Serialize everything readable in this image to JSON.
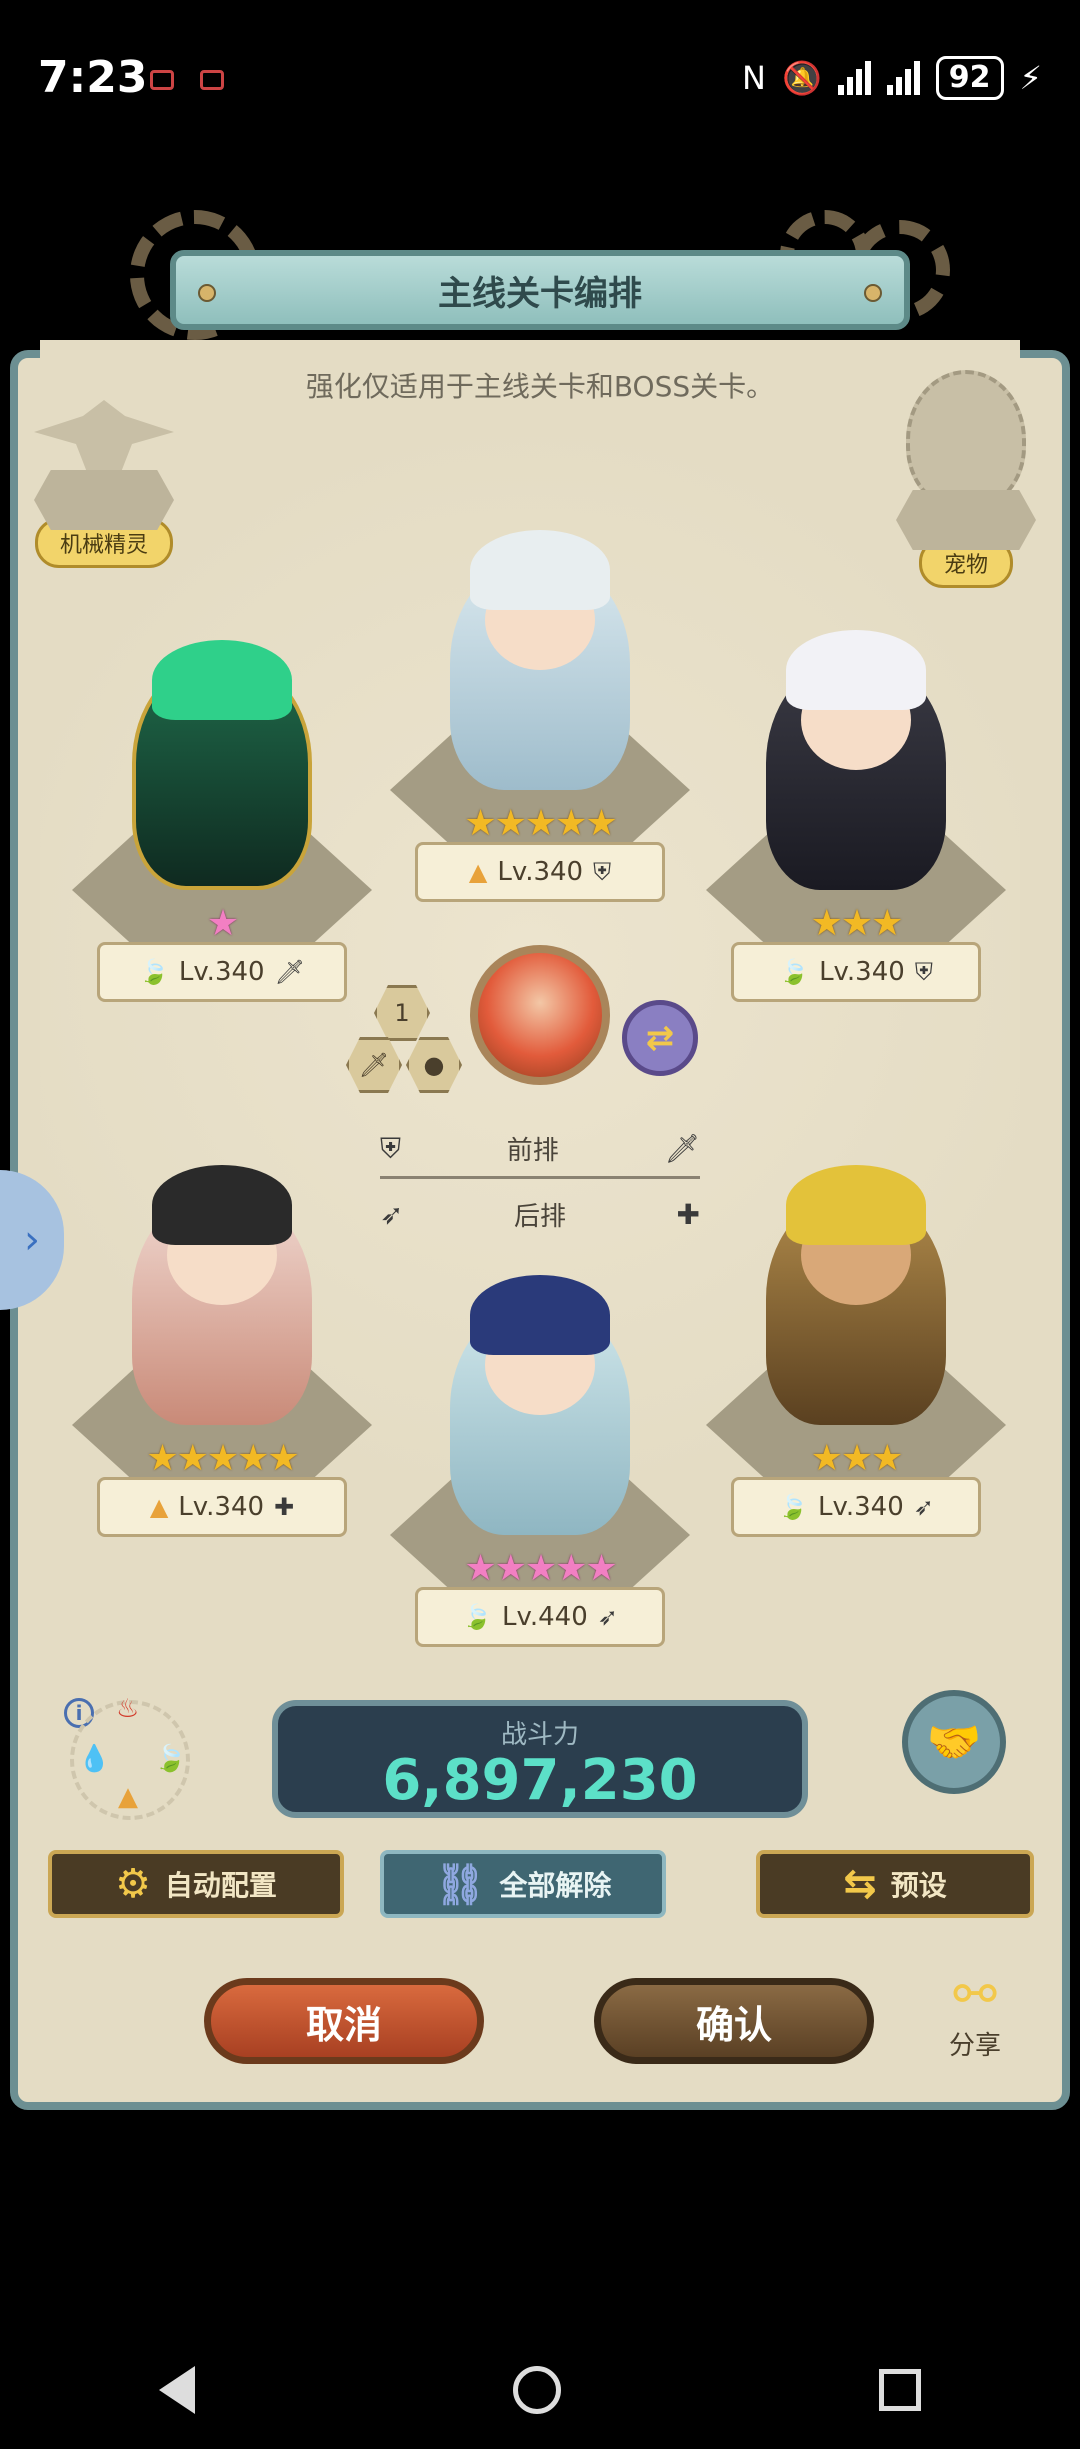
{
  "status_bar": {
    "time": "7:23",
    "battery": "92",
    "icons": [
      "nfc-icon",
      "mute-icon",
      "signal-icon",
      "signal-icon",
      "battery-icon",
      "charging-icon"
    ]
  },
  "dialog": {
    "title": "主线关卡编排",
    "subtitle": "强化仅适用于主线关卡和BOSS关卡。",
    "left_slot_label": "机械精灵",
    "right_slot_label": "宠物"
  },
  "heroes": [
    {
      "stars": "★",
      "star_color": "pink",
      "level": "Lv.340",
      "element": "wind",
      "role": "sword"
    },
    {
      "stars": "★★★★★",
      "star_color": "gold",
      "level": "Lv.340",
      "element": "earth",
      "role": "shield"
    },
    {
      "stars": "★★★",
      "star_color": "gold",
      "level": "Lv.340",
      "element": "wind",
      "role": "shield"
    },
    {
      "stars": "★★★★★",
      "star_color": "gold",
      "level": "Lv.340",
      "element": "earth",
      "role": "heal"
    },
    {
      "stars": "★★★★★",
      "star_color": "pink",
      "level": "Lv.440",
      "element": "wind",
      "role": "bow"
    },
    {
      "stars": "★★★",
      "star_color": "gold",
      "level": "Lv.340",
      "element": "wind",
      "role": "bow"
    }
  ],
  "center_hub": {
    "rank": "1"
  },
  "row_legend": {
    "front": "前排",
    "back": "后排"
  },
  "power": {
    "label": "战斗力",
    "value": "6,897,230"
  },
  "buttons": {
    "auto": "自动配置",
    "clear_all": "全部解除",
    "preset": "预设",
    "cancel": "取消",
    "confirm": "确认",
    "share": "分享"
  },
  "colors": {
    "panel": "#e4dcc4",
    "banner": "#8fbfbc",
    "power_value": "#5ce0c8",
    "cancel": "#c0532e"
  }
}
